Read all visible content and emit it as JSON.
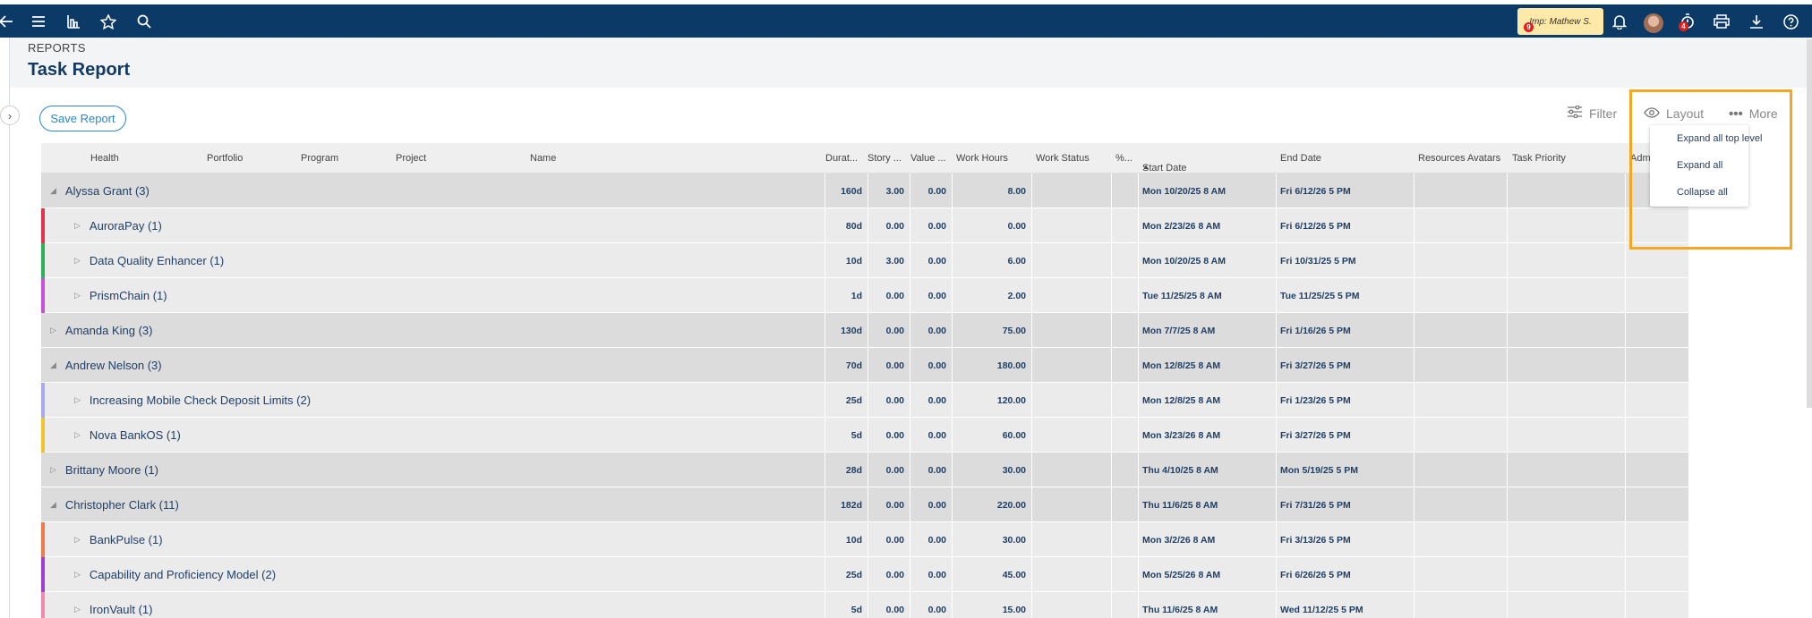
{
  "topbar": {
    "impersonation_label": "Imp: Mathew S.",
    "impersonation_count": "9",
    "timer_count": "4"
  },
  "breadcrumb": "REPORTS",
  "page_title": "Task Report",
  "toolbar": {
    "save_report": "Save Report",
    "filter": "Filter",
    "layout": "Layout",
    "more": "More"
  },
  "layout_menu": {
    "items": [
      "Expand all top level",
      "Expand all",
      "Collapse all"
    ]
  },
  "columns": {
    "health": "Health",
    "portfolio": "Portfolio",
    "program": "Program",
    "project": "Project",
    "name": "Name",
    "duration": "Durat...",
    "story": "Story ...",
    "value": "Value ...",
    "work_hours": "Work Hours",
    "work_status": "Work Status",
    "pct": "%...",
    "start_date": "Start Date",
    "end_date": "End Date",
    "resources_avatars": "Resources Avatars",
    "task_priority": "Task Priority",
    "admin": "Admi"
  },
  "colors": {
    "topbar": "#0b3a66",
    "accent": "#2f86c9",
    "highlight": "#f5a623"
  },
  "rows": [
    {
      "level": "group",
      "expanded": true,
      "name": "Alyssa Grant (3)",
      "duration": "160d",
      "story": "3.00",
      "value": "0.00",
      "work_hours": "8.00",
      "start": "Mon 10/20/25 8 AM",
      "end": "Fri 6/12/26 5 PM",
      "color": ""
    },
    {
      "level": "sub",
      "expanded": false,
      "name": "AuroraPay (1)",
      "duration": "80d",
      "story": "0.00",
      "value": "0.00",
      "work_hours": "0.00",
      "start": "Mon 2/23/26 8 AM",
      "end": "Fri 6/12/26 5 PM",
      "color": "#e0344c"
    },
    {
      "level": "sub",
      "expanded": false,
      "name": "Data Quality Enhancer (1)",
      "duration": "10d",
      "story": "3.00",
      "value": "0.00",
      "work_hours": "6.00",
      "start": "Mon 10/20/25 8 AM",
      "end": "Fri 10/31/25 5 PM",
      "color": "#2db057"
    },
    {
      "level": "sub",
      "expanded": false,
      "name": "PrismChain (1)",
      "duration": "1d",
      "story": "0.00",
      "value": "0.00",
      "work_hours": "2.00",
      "start": "Tue 11/25/25 8 AM",
      "end": "Tue 11/25/25 5 PM",
      "color": "#c84fd8"
    },
    {
      "level": "group",
      "expanded": false,
      "name": "Amanda King (3)",
      "duration": "130d",
      "story": "0.00",
      "value": "0.00",
      "work_hours": "75.00",
      "start": "Mon 7/7/25 8 AM",
      "end": "Fri 1/16/26 5 PM",
      "color": ""
    },
    {
      "level": "group",
      "expanded": true,
      "name": "Andrew Nelson (3)",
      "duration": "70d",
      "story": "0.00",
      "value": "0.00",
      "work_hours": "180.00",
      "start": "Mon 12/8/25 8 AM",
      "end": "Fri 3/27/26 5 PM",
      "color": ""
    },
    {
      "level": "sub",
      "expanded": false,
      "name": "Increasing Mobile Check Deposit Limits (2)",
      "duration": "25d",
      "story": "0.00",
      "value": "0.00",
      "work_hours": "120.00",
      "start": "Mon 12/8/25 8 AM",
      "end": "Fri 1/23/26 5 PM",
      "color": "#a9a9ee"
    },
    {
      "level": "sub",
      "expanded": false,
      "name": "Nova BankOS (1)",
      "duration": "5d",
      "story": "0.00",
      "value": "0.00",
      "work_hours": "60.00",
      "start": "Mon 3/23/26 8 AM",
      "end": "Fri 3/27/26 5 PM",
      "color": "#f2c230"
    },
    {
      "level": "group",
      "expanded": false,
      "name": "Brittany Moore (1)",
      "duration": "28d",
      "story": "0.00",
      "value": "0.00",
      "work_hours": "30.00",
      "start": "Thu 4/10/25 8 AM",
      "end": "Mon 5/19/25 5 PM",
      "color": ""
    },
    {
      "level": "group",
      "expanded": true,
      "name": "Christopher Clark (11)",
      "duration": "182d",
      "story": "0.00",
      "value": "0.00",
      "work_hours": "220.00",
      "start": "Thu 11/6/25 8 AM",
      "end": "Fri 7/31/26 5 PM",
      "color": ""
    },
    {
      "level": "sub",
      "expanded": false,
      "name": "BankPulse (1)",
      "duration": "10d",
      "story": "0.00",
      "value": "0.00",
      "work_hours": "30.00",
      "start": "Mon 3/2/26 8 AM",
      "end": "Fri 3/13/26 5 PM",
      "color": "#f07a4a"
    },
    {
      "level": "sub",
      "expanded": false,
      "name": "Capability and Proficiency Model (2)",
      "duration": "25d",
      "story": "0.00",
      "value": "0.00",
      "work_hours": "45.00",
      "start": "Mon 5/25/26 8 AM",
      "end": "Fri 6/26/26 5 PM",
      "color": "#9b3fd6"
    },
    {
      "level": "sub",
      "expanded": false,
      "name": "IronVault (1)",
      "duration": "5d",
      "story": "0.00",
      "value": "0.00",
      "work_hours": "15.00",
      "start": "Thu 11/6/25 8 AM",
      "end": "Wed 11/12/25 5 PM",
      "color": "#f08aa8"
    }
  ]
}
